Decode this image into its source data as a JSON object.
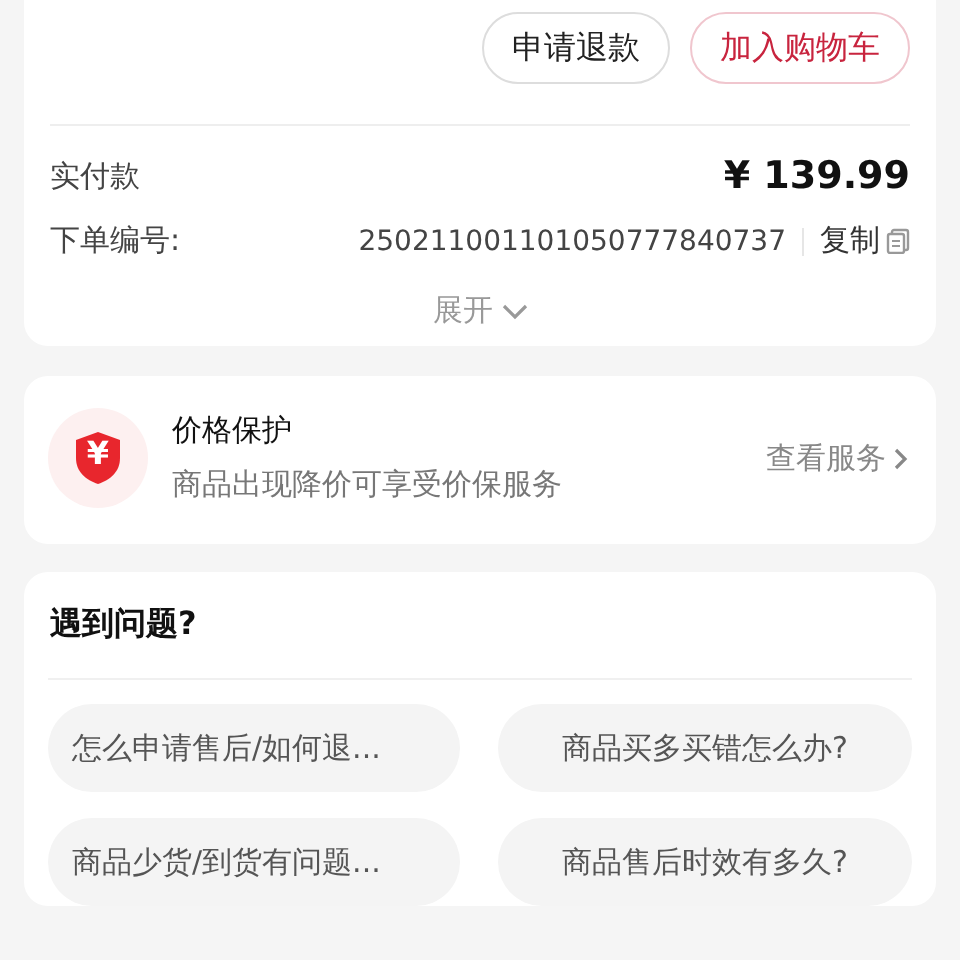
{
  "order_card": {
    "buttons": [
      {
        "label": "申请退款",
        "kind": "plain"
      },
      {
        "label": "加入购物车",
        "kind": "accent"
      }
    ],
    "paid": {
      "label": "实付款",
      "value": "¥ 139.99"
    },
    "order_number": {
      "label": "下单编号:",
      "value": "250211001101050777840737",
      "copy": "复制"
    },
    "expand": "展开"
  },
  "price_protection": {
    "title": "价格保护",
    "subtitle": "商品出现降价可享受价保服务",
    "link": "查看服务",
    "badge": "¥"
  },
  "help": {
    "title": "遇到问题?",
    "questions": [
      "怎么申请售后/如何退...",
      "商品买多买错怎么办?",
      "商品少货/到货有问题...",
      "商品售后时效有多久?"
    ]
  }
}
